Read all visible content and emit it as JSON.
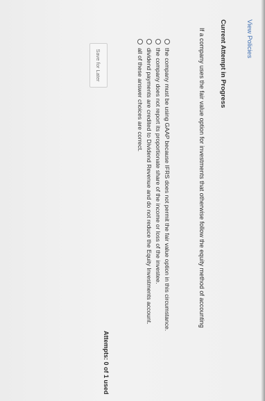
{
  "header": {
    "view_policies": "View Policies",
    "attempt_status": "Current Attempt in Progress"
  },
  "question": {
    "text": "If a company uses the fair value option for investments that otherwise follow the equity method of accounting"
  },
  "options": [
    {
      "label": "the company must be using GAAP because IFRS does not permit the fair value option in this circumstance."
    },
    {
      "label": "the company does not report its proportionate share of the income or loss of the investee."
    },
    {
      "label": "dividend payments are credited to Dividend Revenue and do not reduce the Equity Investments account."
    },
    {
      "label": "all of these answer choices are correct."
    }
  ],
  "footer": {
    "save_for_later": "Save for Later",
    "attempts": "Attempts: 0 of 1 used"
  },
  "colors": {
    "link": "#3f6fb2",
    "background": "#f0f0f0"
  }
}
